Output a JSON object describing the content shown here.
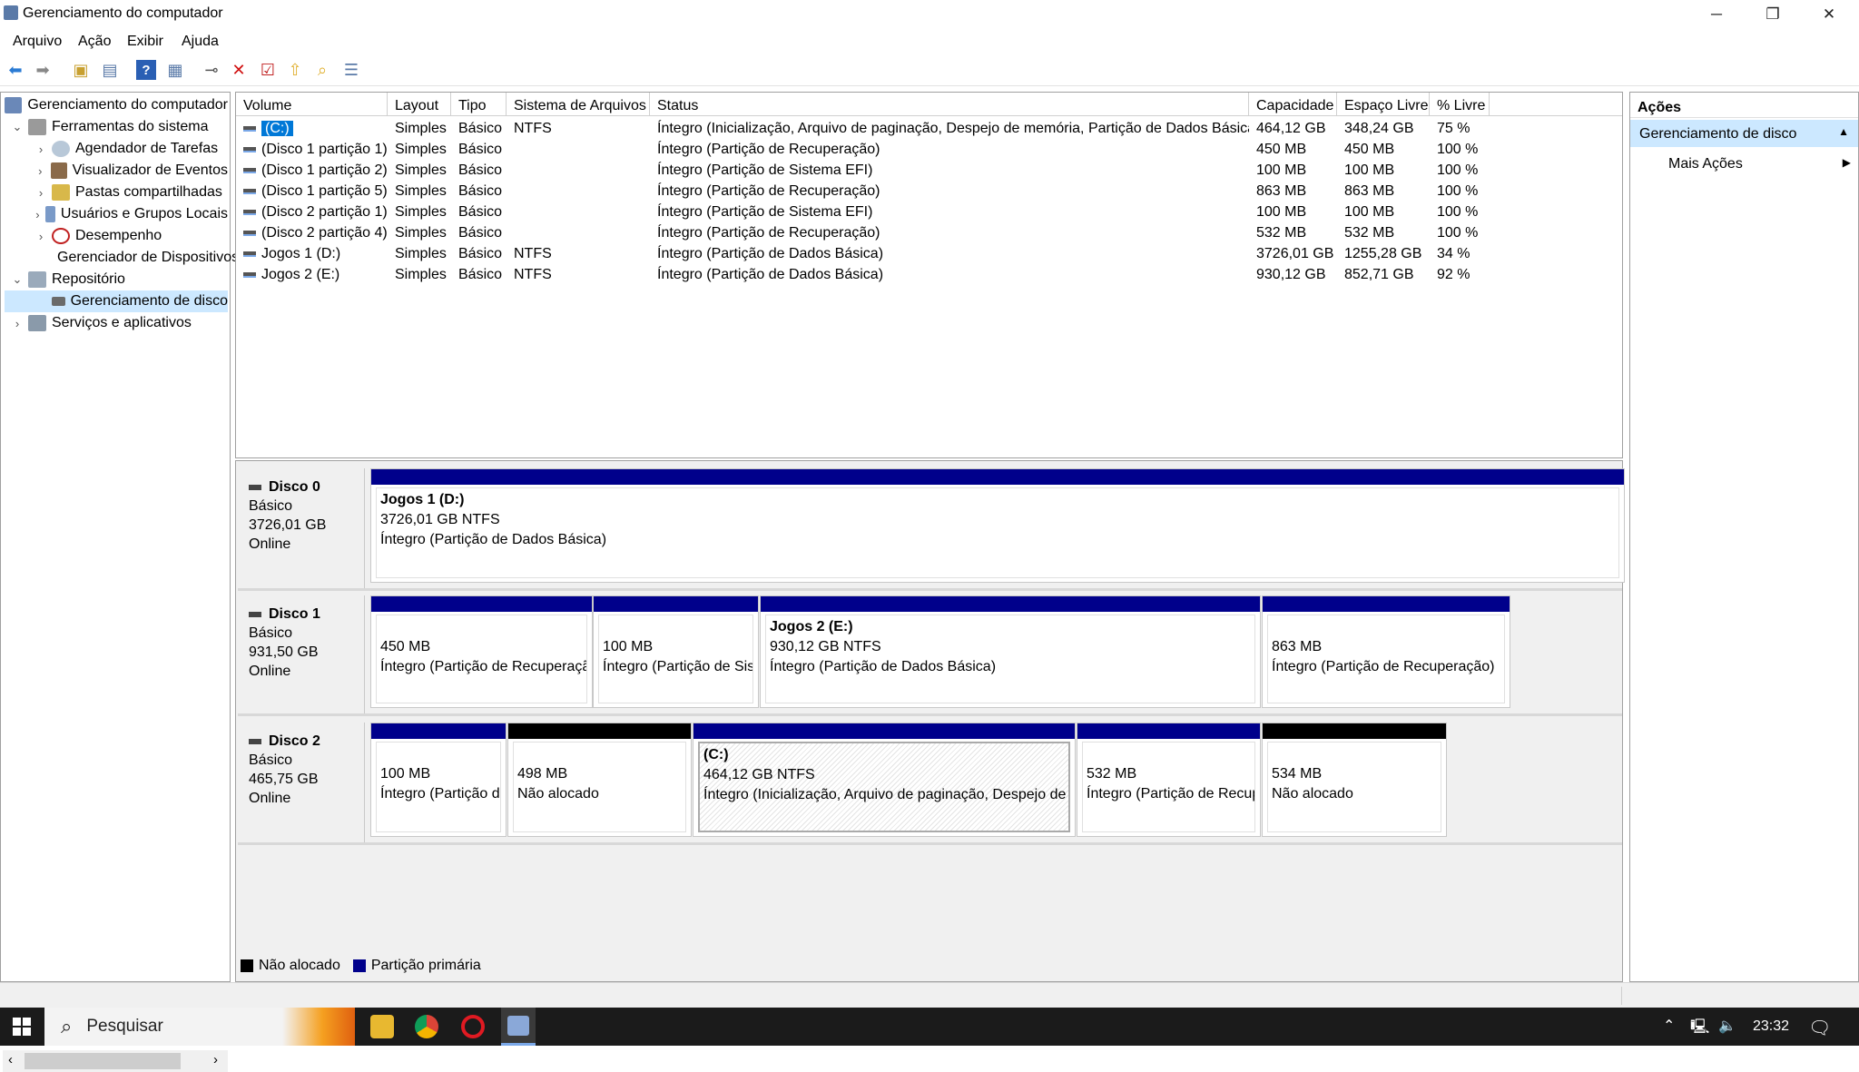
{
  "window": {
    "title": "Gerenciamento do computador",
    "minimize": "─",
    "restore": "❐",
    "close": "✕"
  },
  "menu": [
    "Arquivo",
    "Ação",
    "Exibir",
    "Ajuda"
  ],
  "tree": {
    "root": "Gerenciamento do computador",
    "system_tools": "Ferramentas do sistema",
    "task_scheduler": "Agendador de Tarefas",
    "event_viewer": "Visualizador de Eventos",
    "shared_folders": "Pastas compartilhadas",
    "users_groups": "Usuários e Grupos Locais",
    "performance": "Desempenho",
    "device_manager": "Gerenciador de Dispositivos",
    "storage": "Repositório",
    "disk_management": "Gerenciamento de disco",
    "services_apps": "Serviços e aplicativos"
  },
  "volumes": {
    "headers": [
      "Volume",
      "Layout",
      "Tipo",
      "Sistema de Arquivos",
      "Status",
      "Capacidade",
      "Espaço Livre",
      "% Livre"
    ],
    "rows": [
      [
        "(C:)",
        "Simples",
        "Básico",
        "NTFS",
        "Íntegro (Inicialização, Arquivo de paginação, Despejo de memória, Partição de Dados Básica)",
        "464,12 GB",
        "348,24 GB",
        "75 %"
      ],
      [
        "(Disco 1 partição 1)",
        "Simples",
        "Básico",
        "",
        "Íntegro (Partição de Recuperação)",
        "450 MB",
        "450 MB",
        "100 %"
      ],
      [
        "(Disco 1 partição 2)",
        "Simples",
        "Básico",
        "",
        "Íntegro (Partição de Sistema EFI)",
        "100 MB",
        "100 MB",
        "100 %"
      ],
      [
        "(Disco 1 partição 5)",
        "Simples",
        "Básico",
        "",
        "Íntegro (Partição de Recuperação)",
        "863 MB",
        "863 MB",
        "100 %"
      ],
      [
        "(Disco 2 partição 1)",
        "Simples",
        "Básico",
        "",
        "Íntegro (Partição de Sistema EFI)",
        "100 MB",
        "100 MB",
        "100 %"
      ],
      [
        "(Disco 2 partição 4)",
        "Simples",
        "Básico",
        "",
        "Íntegro (Partição de Recuperação)",
        "532 MB",
        "532 MB",
        "100 %"
      ],
      [
        "Jogos 1 (D:)",
        "Simples",
        "Básico",
        "NTFS",
        "Íntegro (Partição de Dados Básica)",
        "3726,01 GB",
        "1255,28 GB",
        "34 %"
      ],
      [
        "Jogos 2 (E:)",
        "Simples",
        "Básico",
        "NTFS",
        "Íntegro (Partição de Dados Básica)",
        "930,12 GB",
        "852,71 GB",
        "92 %"
      ]
    ]
  },
  "disks": [
    {
      "name": "Disco 0",
      "type": "Básico",
      "size": "3726,01 GB",
      "state": "Online",
      "parts": [
        {
          "title": "Jogos 1  (D:)",
          "size": "3726,01 GB NTFS",
          "status": "Íntegro (Partição de Dados Básica)",
          "color": "#00008b"
        }
      ]
    },
    {
      "name": "Disco 1",
      "type": "Básico",
      "size": "931,50 GB",
      "state": "Online",
      "parts": [
        {
          "title": "",
          "size": "450 MB",
          "status": "Íntegro (Partição de Recuperação)",
          "color": "#00008b"
        },
        {
          "title": "",
          "size": "100 MB",
          "status": "Íntegro (Partição de Sistema EFI)",
          "color": "#00008b"
        },
        {
          "title": "Jogos 2  (E:)",
          "size": "930,12 GB NTFS",
          "status": "Íntegro (Partição de Dados Básica)",
          "color": "#00008b"
        },
        {
          "title": "",
          "size": "863 MB",
          "status": "Íntegro (Partição de Recuperação)",
          "color": "#00008b"
        }
      ]
    },
    {
      "name": "Disco 2",
      "type": "Básico",
      "size": "465,75 GB",
      "state": "Online",
      "parts": [
        {
          "title": "",
          "size": "100 MB",
          "status": "Íntegro (Partição de Sistema EFI)",
          "color": "#00008b"
        },
        {
          "title": "",
          "size": "498 MB",
          "status": "Não alocado",
          "color": "#000000"
        },
        {
          "title": "(C:)",
          "size": "464,12 GB NTFS",
          "status": "Íntegro (Inicialização, Arquivo de paginação, Despejo de memória, Partição de Dados Básica)",
          "color": "#00008b"
        },
        {
          "title": "",
          "size": "532 MB",
          "status": "Íntegro (Partição de Recuperação)",
          "color": "#00008b"
        },
        {
          "title": "",
          "size": "534 MB",
          "status": "Não alocado",
          "color": "#000000"
        }
      ]
    }
  ],
  "legend": {
    "unallocated": "Não alocado",
    "primary": "Partição primária",
    "unallocated_color": "#000000",
    "primary_color": "#00008b"
  },
  "actions": {
    "header": "Ações",
    "section": "Gerenciamento de disco",
    "more": "Mais Ações"
  },
  "taskbar": {
    "search_placeholder": "Pesquisar",
    "time": "23:32"
  },
  "colors": {
    "selection": "#cce8ff",
    "primary_partition": "#00008b",
    "unallocated": "#000000"
  }
}
